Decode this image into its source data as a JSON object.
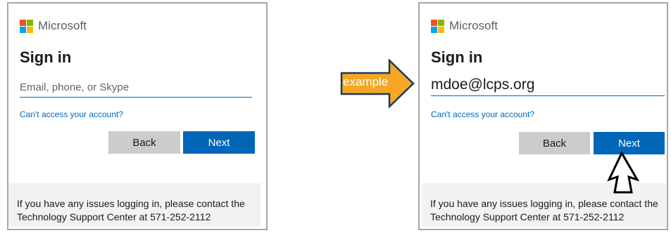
{
  "brand": {
    "name": "Microsoft",
    "colors": [
      "#f25022",
      "#7fba00",
      "#00a4ef",
      "#ffb900"
    ]
  },
  "left_panel": {
    "title": "Sign in",
    "email": {
      "value": "",
      "placeholder": "Email, phone, or Skype"
    },
    "cant_access_link": "Can't access your account?",
    "back_label": "Back",
    "next_label": "Next",
    "footer_text": "If you have any issues logging in, please contact the Technology Support Center at 571-252-2112"
  },
  "annotation": {
    "label": "example",
    "arrow_fill": "#f5a623",
    "arrow_outline": "#1f3a5f"
  },
  "right_panel": {
    "title": "Sign in",
    "email": {
      "value": "mdoe@lcps.org",
      "placeholder": ""
    },
    "cant_access_link": "Can't access your account?",
    "back_label": "Back",
    "next_label": "Next",
    "footer_text": "If you have any issues logging in, please contact the Technology Support Center at 571-252-2112"
  },
  "cursor": {
    "icon": "pointer-arrow-icon"
  }
}
